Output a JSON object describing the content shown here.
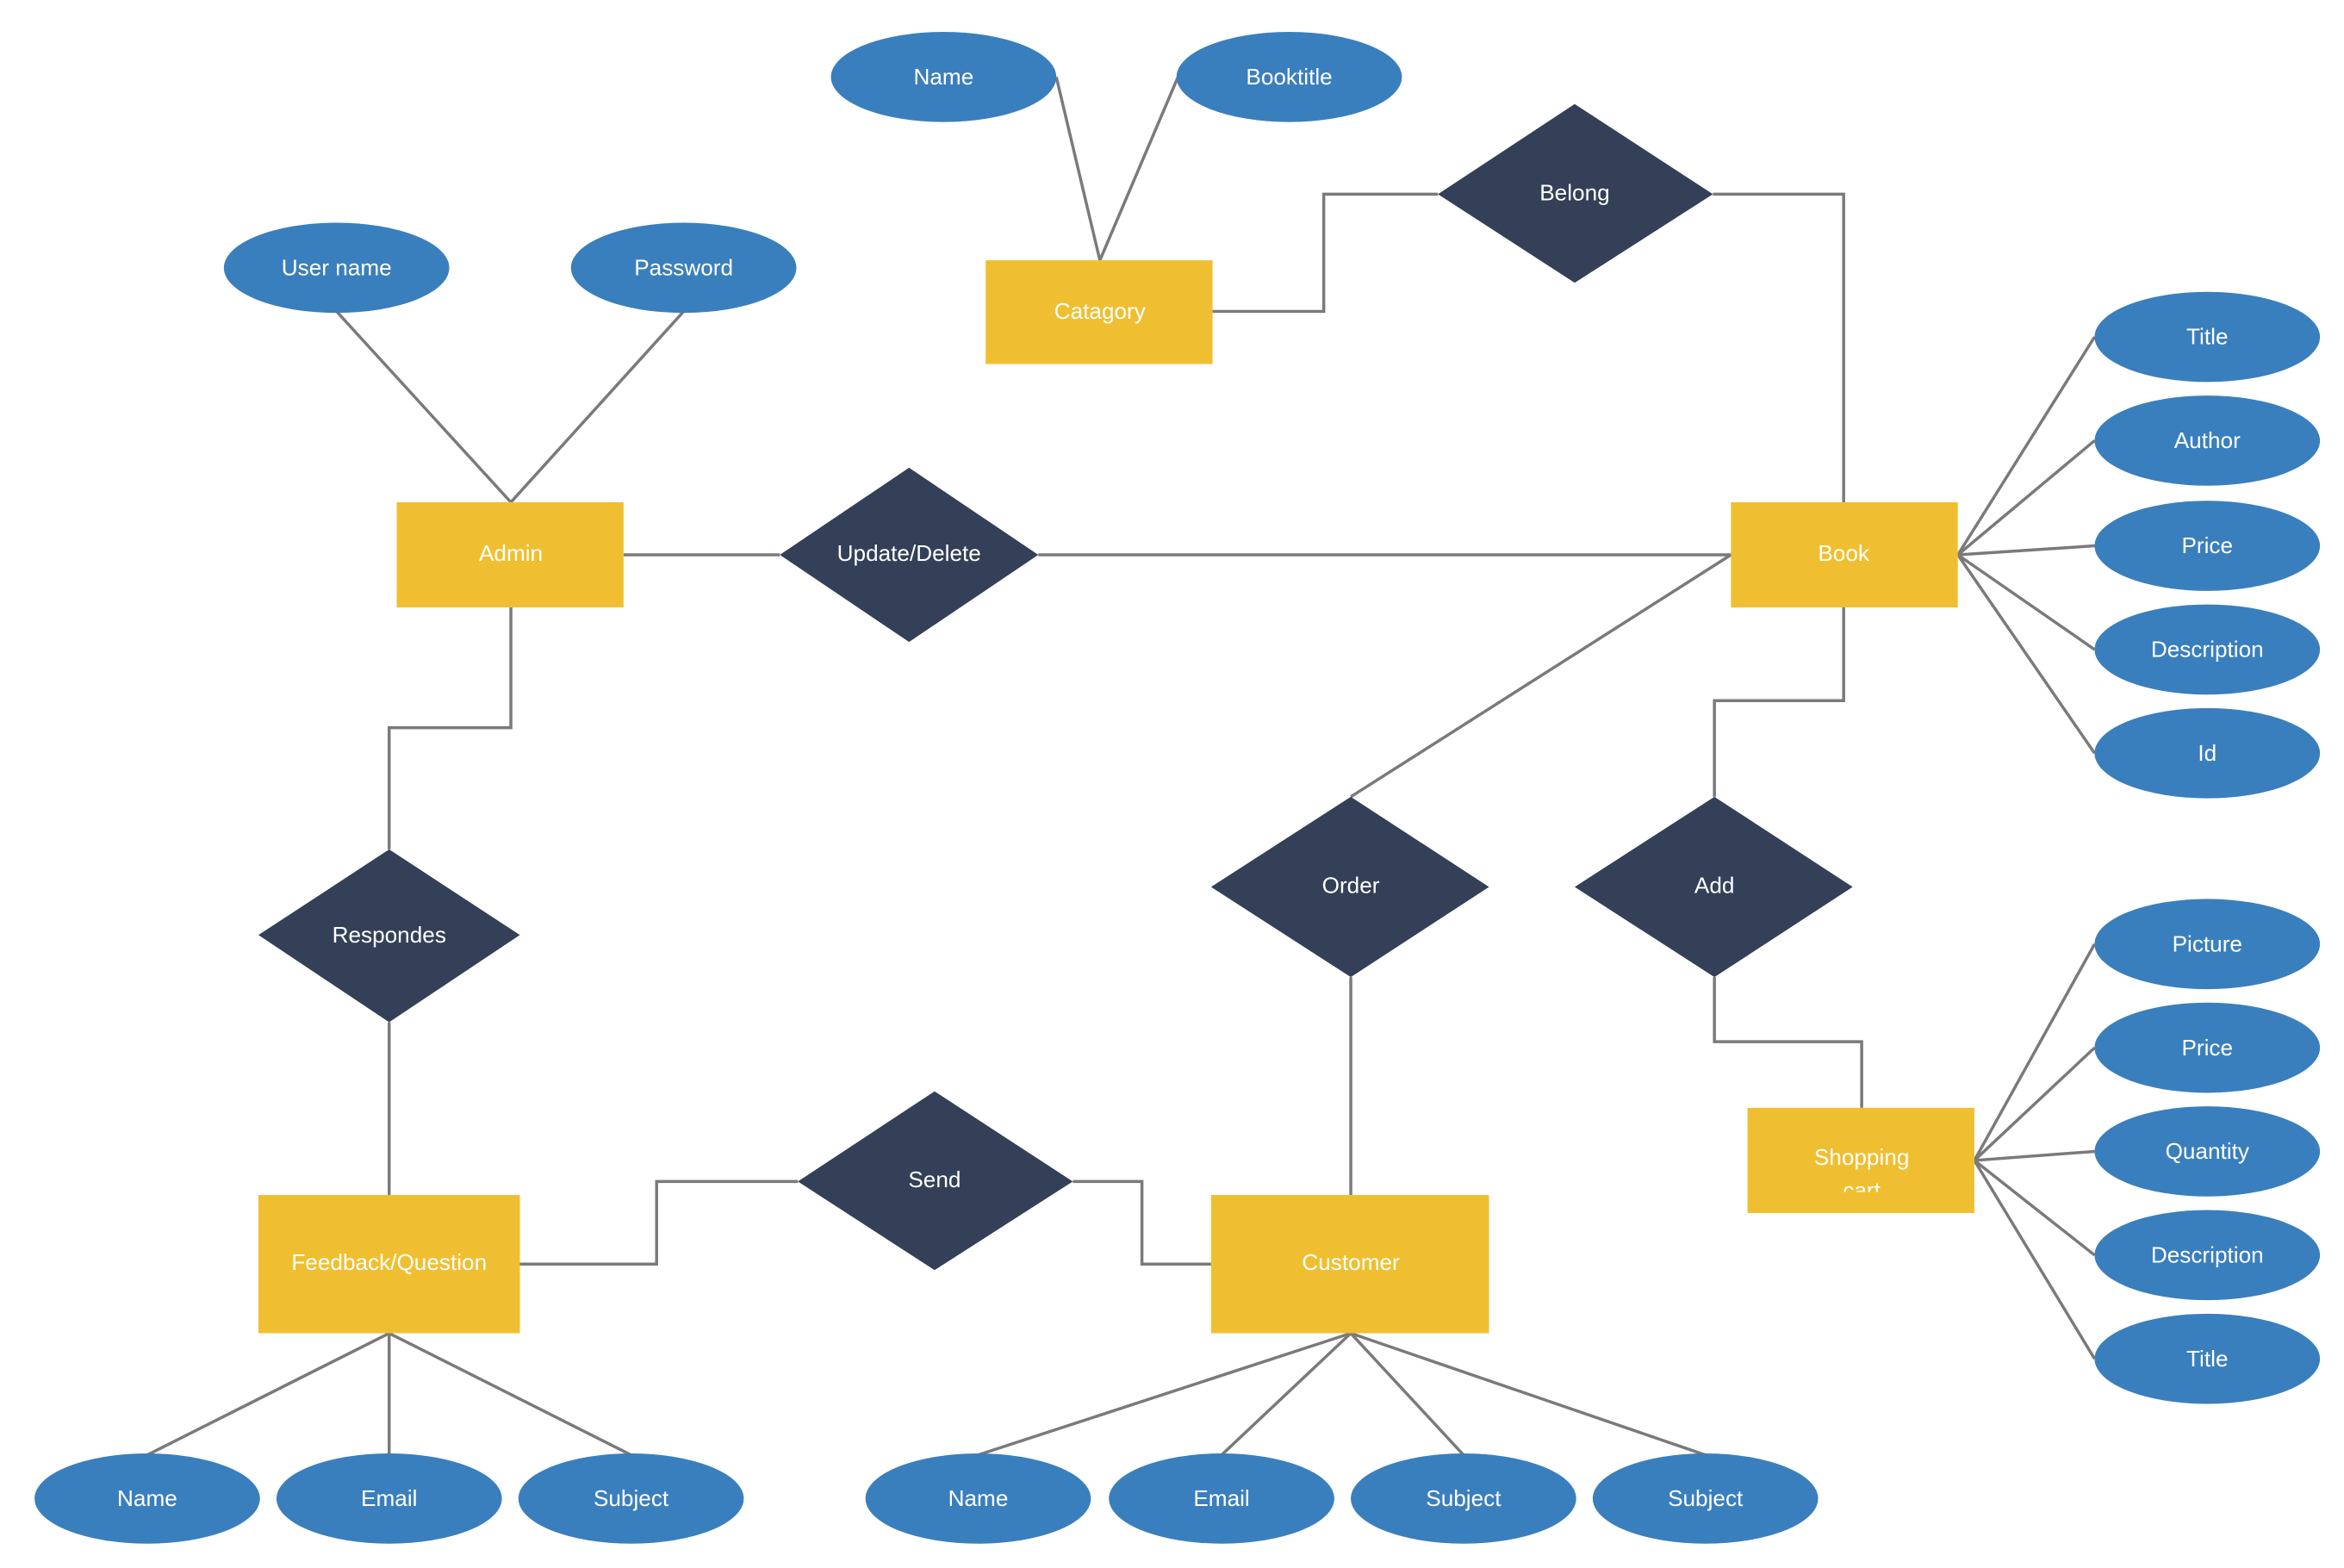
{
  "diagram": {
    "type": "ER diagram",
    "colors": {
      "entity": "#f0bf31",
      "attribute": "#3a7fbd",
      "relationship": "#344058",
      "connector": "#7a7a7a",
      "label": "#ffffff"
    },
    "entities": {
      "admin": "Admin",
      "catagory": "Catagory",
      "book": "Book",
      "feedback": "Feedback/Question",
      "customer": "Customer",
      "shopping_cart_line1": "Shopping",
      "shopping_cart_line2": "cart"
    },
    "relationships": {
      "belong": "Belong",
      "update_delete": "Update/Delete",
      "respondes": "Respondes",
      "order": "Order",
      "add": "Add",
      "send": "Send"
    },
    "attributes": {
      "admin": [
        "User name",
        "Password"
      ],
      "catagory": [
        "Name",
        "Booktitle"
      ],
      "book": [
        "Title",
        "Author",
        "Price",
        "Description",
        "Id"
      ],
      "shopping_cart": [
        "Picture",
        "Price",
        "Quantity",
        "Description",
        "Title"
      ],
      "feedback": [
        "Name",
        "Email",
        "Subject"
      ],
      "customer": [
        "Name",
        "Email",
        "Subject",
        "Subject"
      ]
    },
    "connections": [
      [
        "Admin",
        "Update/Delete",
        "Book"
      ],
      [
        "Catagory",
        "Belong",
        "Book"
      ],
      [
        "Admin",
        "Respondes",
        "Feedback/Question"
      ],
      [
        "Feedback/Question",
        "Send",
        "Customer"
      ],
      [
        "Customer",
        "Order",
        "Book"
      ],
      [
        "Shopping cart",
        "Add",
        "Book"
      ]
    ]
  }
}
